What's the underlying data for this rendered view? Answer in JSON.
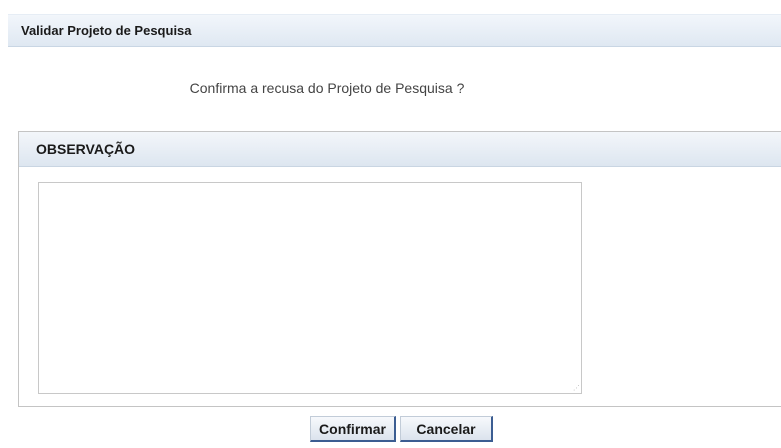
{
  "page": {
    "title": "Validar Projeto de Pesquisa",
    "question": "Confirma a recusa do Projeto de Pesquisa ?"
  },
  "observacao": {
    "header": "OBSERVAÇÃO",
    "value": "",
    "resize_grip_glyph": "⋰"
  },
  "actions": {
    "confirm_label": "Confirmar",
    "cancel_label": "Cancelar"
  },
  "colors": {
    "header_gradient_top": "#f2f6fb",
    "header_gradient_bottom": "#dfe8f2",
    "button_accent_border": "#3b5d92",
    "text": "#1a1a1a",
    "question_text": "#444444"
  }
}
